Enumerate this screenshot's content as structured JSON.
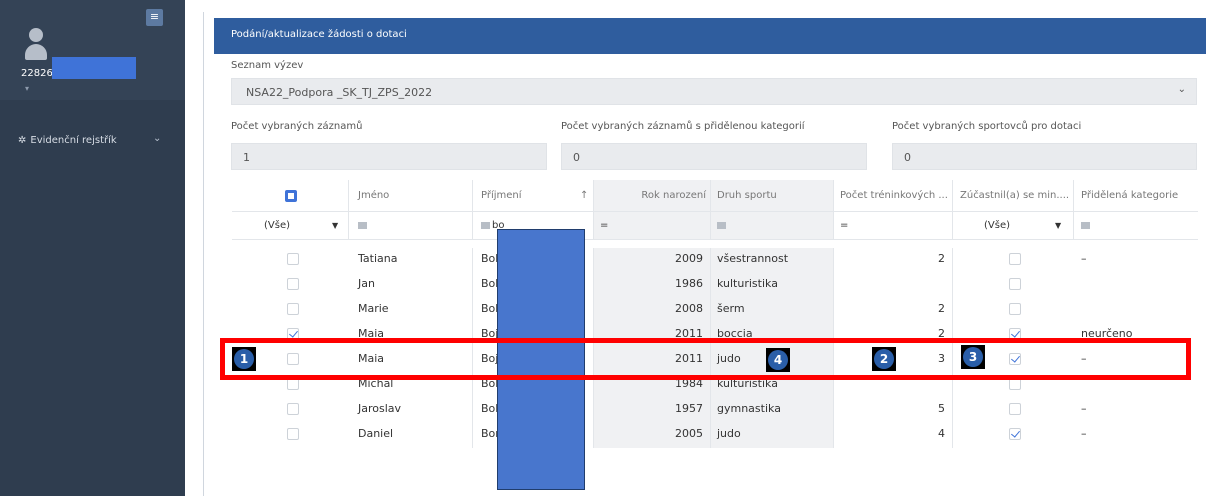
{
  "sidebar": {
    "menu_icon": "menu-icon",
    "user_id": "22826",
    "nav_item": "Evidenční rejstřík",
    "nav_icon": "asterisk-icon"
  },
  "panel": {
    "title": "Podání/aktualizace žádosti o dotaci",
    "list_label": "Seznam výzev",
    "selected_call": "NSA22_Podpora _SK_TJ_ZPS_2022",
    "count_label": "Počet vybraných záznamů",
    "count_value": "1",
    "category_label": "Počet vybraných záznamů s přidělenou kategorií",
    "category_value": "0",
    "athletes_label": "Počet vybraných sportovců pro dotaci",
    "athletes_value": "0"
  },
  "table": {
    "columns": [
      "Jméno",
      "Příjmení",
      "Rok narození",
      "Druh sportu",
      "Počet tréninkových ...",
      "Zúčastnil(a) se min....",
      "Přidělená kategorie"
    ],
    "sort_icon": "sort-arrow-icon",
    "filters": {
      "select_all": "(Vše)",
      "surname": "bo",
      "rok": "=",
      "trenink": "=",
      "zucastnil": "(Vše)"
    },
    "rows": [
      {
        "selected": false,
        "jmeno": "Tatiana",
        "prijmeni": "Bob",
        "rok": "2009",
        "sport": "všestrannost",
        "trenink": "2",
        "zucastnil": false,
        "kategorie": "–"
      },
      {
        "selected": false,
        "jmeno": "Jan",
        "prijmeni": "Boh",
        "rok": "1986",
        "sport": "kulturistika",
        "trenink": "",
        "zucastnil": false,
        "kategorie": ""
      },
      {
        "selected": false,
        "jmeno": "Marie",
        "prijmeni": "Boh",
        "rok": "2008",
        "sport": "šerm",
        "trenink": "2",
        "zucastnil": false,
        "kategorie": ""
      },
      {
        "selected": true,
        "jmeno": "Maia",
        "prijmeni": "Boja",
        "rok": "2011",
        "sport": "boccia",
        "trenink": "2",
        "zucastnil": true,
        "kategorie": "neurčeno"
      },
      {
        "selected": false,
        "jmeno": "Maia",
        "prijmeni": "Boja",
        "rok": "2011",
        "sport": "judo",
        "trenink": "3",
        "zucastnil": true,
        "kategorie": "–"
      },
      {
        "selected": false,
        "jmeno": "Michal",
        "prijmeni": "Bolt",
        "rok": "1984",
        "sport": "kulturistika",
        "trenink": "",
        "zucastnil": false,
        "kategorie": ""
      },
      {
        "selected": false,
        "jmeno": "Jaroslav",
        "prijmeni": "Bolt",
        "rok": "1957",
        "sport": "gymnastika",
        "trenink": "5",
        "zucastnil": false,
        "kategorie": "–"
      },
      {
        "selected": false,
        "jmeno": "Daniel",
        "prijmeni": "Bor",
        "rok": "2005",
        "sport": "judo",
        "trenink": "4",
        "zucastnil": true,
        "kategorie": "–"
      }
    ]
  },
  "annotations": {
    "marker_1": "1",
    "marker_2": "2",
    "marker_3": "3",
    "marker_4": "4",
    "highlight_color": "#ff0000"
  }
}
